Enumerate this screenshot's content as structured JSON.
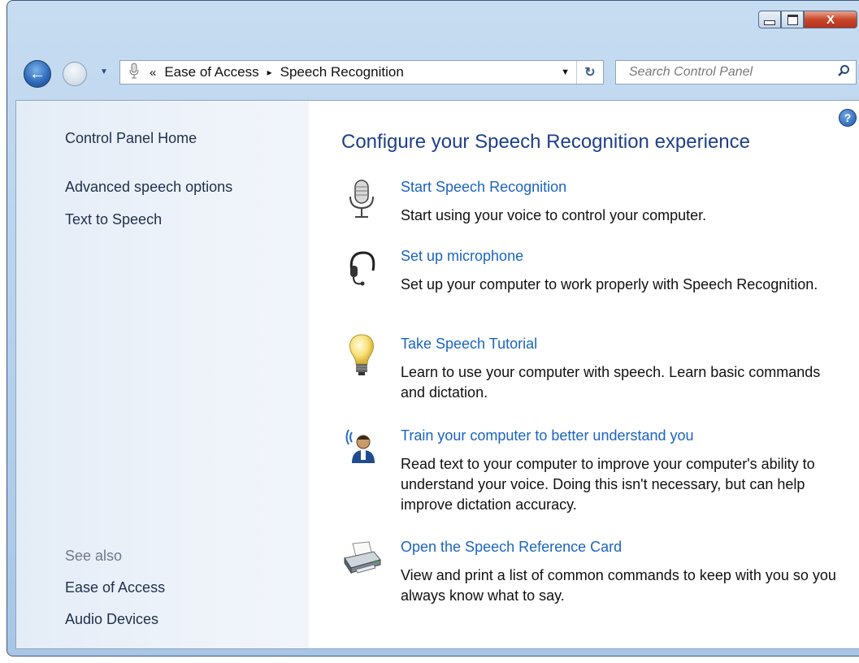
{
  "window": {
    "minimize_glyph": "",
    "close_glyph": "X"
  },
  "nav": {
    "back_glyph": "←",
    "forward_glyph": "→",
    "breadcrumb_chevron": "«",
    "breadcrumbs": [
      "Ease of Access",
      "Speech Recognition"
    ],
    "breadcrumb_separator": "▸",
    "address_dropdown": "▼",
    "refresh_glyph": "↻",
    "search_placeholder": "Search Control Panel"
  },
  "sidebar": {
    "home": "Control Panel Home",
    "items": [
      "Advanced speech options",
      "Text to Speech"
    ],
    "see_also_label": "See also",
    "see_also_items": [
      "Ease of Access",
      "Audio Devices"
    ]
  },
  "main": {
    "title": "Configure your Speech Recognition experience",
    "help_glyph": "?",
    "tasks": [
      {
        "icon": "microphone-icon",
        "label": "Start Speech Recognition",
        "description": "Start using your voice to control your computer."
      },
      {
        "icon": "headset-icon",
        "label": "Set up microphone",
        "description": "Set up your computer to work properly with Speech Recognition."
      },
      {
        "icon": "lightbulb-icon",
        "label": "Take Speech Tutorial",
        "description": "Learn to use your computer with speech.  Learn basic commands and dictation."
      },
      {
        "icon": "speaking-person-icon",
        "label": "Train your computer to better understand you",
        "description": "Read text to your computer to improve your computer's ability to understand your voice.  Doing this isn't necessary, but can help improve dictation accuracy."
      },
      {
        "icon": "printer-icon",
        "label": "Open the Speech Reference Card",
        "description": "View and print a list of common commands to keep with you so you always know what to say."
      }
    ]
  },
  "colors": {
    "link": "#1a64c2",
    "title": "#1e3f8a",
    "sidebar_text": "#1e2f4d",
    "close_button": "#c9472a"
  }
}
